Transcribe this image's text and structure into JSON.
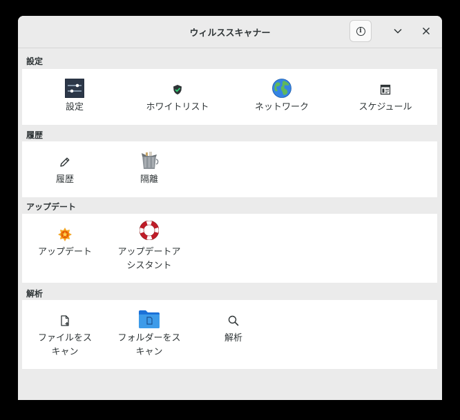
{
  "window": {
    "title": "ウィルススキャナー"
  },
  "sections": [
    {
      "heading": "設定",
      "items": [
        "設定",
        "ホワイトリスト",
        "ネットワーク",
        "スケジュール"
      ]
    },
    {
      "heading": "履歴",
      "items": [
        "履歴",
        "隔離"
      ]
    },
    {
      "heading": "アップデート",
      "items": [
        "アップデート",
        "アップデートア\nシスタント"
      ]
    },
    {
      "heading": "解析",
      "items": [
        "ファイルをス\nキャン",
        "フォルダーをス\nキャン",
        "解析"
      ]
    }
  ],
  "icons": {
    "info": "info-icon",
    "minimize": "chevron-down-icon",
    "close": "close-icon",
    "settings": "sliders-icon",
    "whitelist": "shield-icon",
    "network": "globe-icon",
    "schedule": "calendar-icon",
    "history": "pencil-icon",
    "quarantine": "trash-can-icon",
    "update": "star-badge-icon",
    "update_assistant": "lifebuoy-icon",
    "scan_file": "file-add-icon",
    "scan_folder": "folder-icon",
    "analyze": "magnifier-icon"
  }
}
